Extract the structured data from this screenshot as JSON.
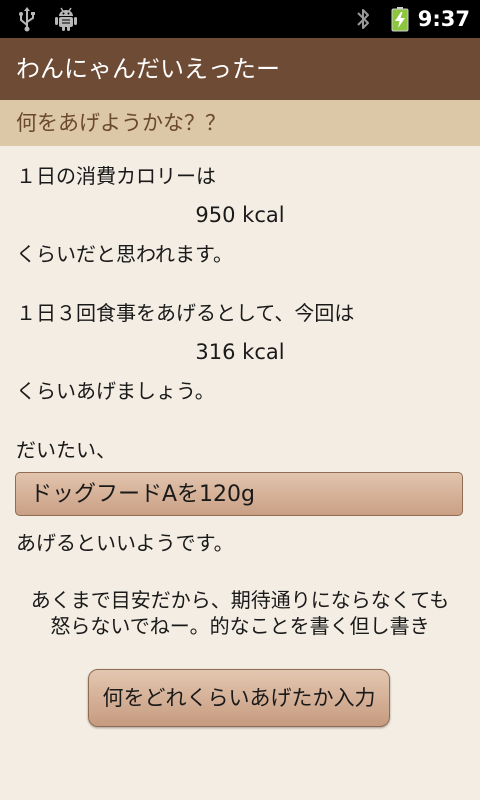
{
  "status_bar": {
    "time": "9:37",
    "icons": [
      "usb-icon",
      "android-debug-icon",
      "bluetooth-icon",
      "battery-charging-icon"
    ]
  },
  "app": {
    "title": "わんにゃんだいえったー"
  },
  "section": {
    "title": "何をあげようかな？？"
  },
  "content": {
    "daily_intro": "１日の消費カロリーは",
    "daily_value": "950 kcal",
    "daily_suffix": "くらいだと思われます。",
    "meal_intro": "１日３回食事をあげるとして、今回は",
    "meal_value": "316 kcal",
    "meal_suffix": "くらいあげましょう。",
    "approx_label": "だいたい、",
    "food_suggestion": "ドッグフードAを120g",
    "food_suffix": "あげるといいようです。",
    "disclaimer_line1": "あくまで目安だから、期待通りにならなくても",
    "disclaimer_line2": "怒らないでねー。的なことを書く但し書き"
  },
  "actions": {
    "input_button_label": "何をどれくらいあげたか入力"
  },
  "colors": {
    "status_bar_bg": "#000000",
    "title_bar_bg": "#6e4b35",
    "section_header_bg": "#dcc7a6",
    "section_title_text": "#6b4a2c",
    "page_bg": "#f3ede3",
    "button_bg": "#d4af96",
    "battery_green": "#8cc63f"
  }
}
